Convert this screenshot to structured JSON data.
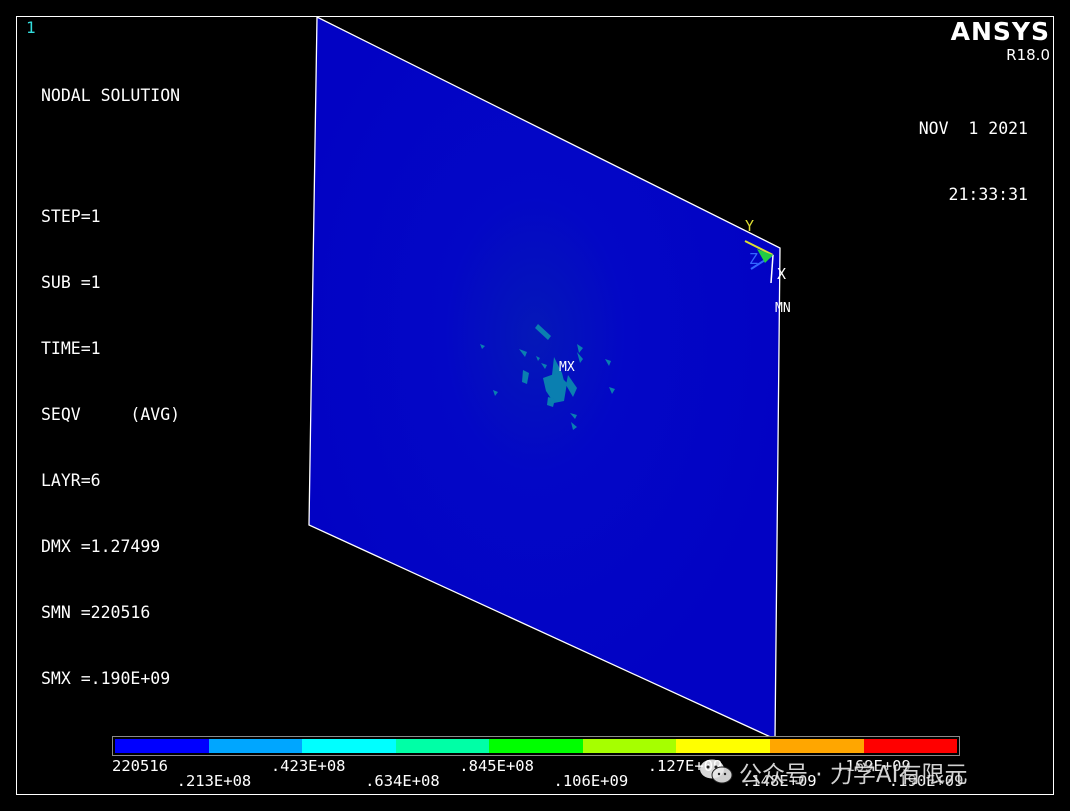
{
  "window_number": "1",
  "solution": {
    "title": "NODAL SOLUTION",
    "lines": [
      "STEP=1",
      "SUB =1",
      "TIME=1",
      "SEQV     (AVG)",
      "LAYR=6",
      "DMX =1.27499",
      "SMN =220516",
      "SMX =.190E+09"
    ]
  },
  "brand": {
    "name": "ANSYS",
    "version": "R18.0"
  },
  "datetime": {
    "date": "NOV  1 2021",
    "time": "21:33:31"
  },
  "markers": {
    "max": "MX",
    "min": "MN"
  },
  "axes": {
    "x": "X",
    "y": "Y",
    "z": "Z"
  },
  "legend": {
    "colors": [
      "#0000ff",
      "#00a6ff",
      "#00ffff",
      "#00ffa6",
      "#00ff00",
      "#a6ff00",
      "#ffff00",
      "#ffa600",
      "#ff0000"
    ],
    "labels": [
      "220516",
      ".213E+08",
      ".423E+08",
      ".634E+08",
      ".845E+08",
      ".106E+09",
      ".127E+09",
      ".148E+09",
      ".169E+09",
      ".190E+09"
    ]
  },
  "colors": {
    "plate": "#0202c4",
    "background": "#000000"
  },
  "watermark": {
    "text": "公众号 · 力学AI有限元"
  }
}
